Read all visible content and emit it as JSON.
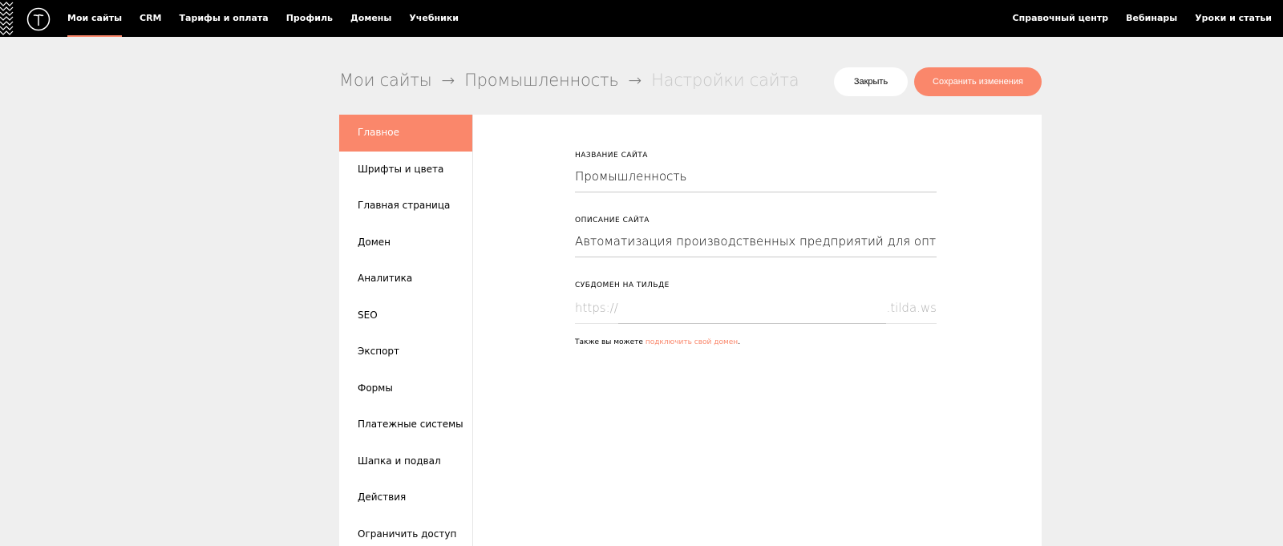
{
  "topbar": {
    "logo": "tilda-logo-icon",
    "nav_left": [
      {
        "label": "Мои сайты",
        "active": true
      },
      {
        "label": "CRM"
      },
      {
        "label": "Тарифы и оплата"
      },
      {
        "label": "Профиль"
      },
      {
        "label": "Домены"
      },
      {
        "label": "Учебники"
      }
    ],
    "nav_right": [
      {
        "label": "Справочный центр"
      },
      {
        "label": "Вебинары"
      },
      {
        "label": "Уроки и статьи"
      }
    ]
  },
  "breadcrumb": {
    "items": [
      "Мои сайты",
      "Промышленность",
      "Настройки сайта"
    ],
    "separator": "→"
  },
  "actions": {
    "close_label": "Закрыть",
    "save_label": "Сохранить изменения"
  },
  "sidebar": {
    "items": [
      {
        "label": "Главное",
        "active": true
      },
      {
        "label": "Шрифты и цвета"
      },
      {
        "label": "Главная страница"
      },
      {
        "label": "Домен"
      },
      {
        "label": "Аналитика"
      },
      {
        "label": "SEO"
      },
      {
        "label": "Экспорт"
      },
      {
        "label": "Формы"
      },
      {
        "label": "Платежные системы"
      },
      {
        "label": "Шапка и подвал"
      },
      {
        "label": "Действия"
      },
      {
        "label": "Ограничить доступ"
      }
    ]
  },
  "form": {
    "site_name": {
      "label": "Название сайта",
      "value": "Промышленность"
    },
    "site_description": {
      "label": "Описание сайта",
      "value": "Автоматизация производственных предприятий для оптимизаци"
    },
    "subdomain": {
      "label": "Субдомен на тильде",
      "prefix": "https://",
      "value": "",
      "suffix": ".tilda.ws"
    },
    "hint": {
      "text": "Также вы можете ",
      "link": "подключить свой домен",
      "end": "."
    }
  },
  "colors": {
    "accent": "#fa876b",
    "topbar": "#000000",
    "background": "#efefef"
  }
}
